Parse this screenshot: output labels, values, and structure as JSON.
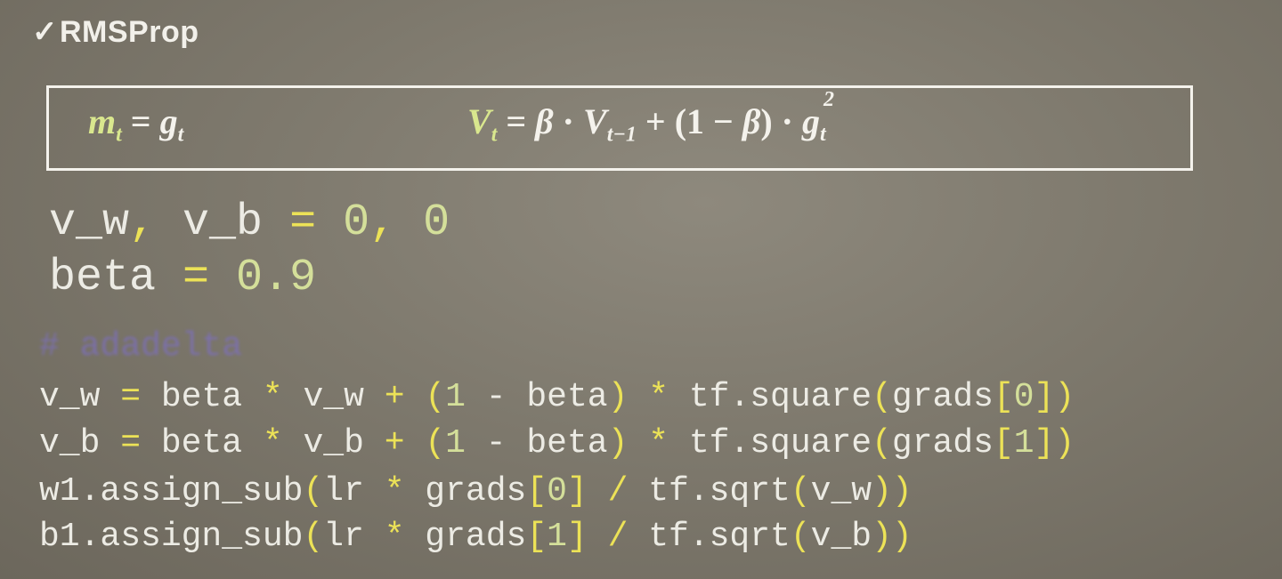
{
  "title": {
    "check": "✓",
    "text": "RMSProp"
  },
  "formulas": {
    "m": "m",
    "m_sub": "t",
    "eq1": " = ",
    "g": "g",
    "g_sub": "t",
    "V": "V",
    "V_sub": "t",
    "eq2": " = ",
    "beta1": "β",
    "dot1": " · ",
    "V2": "V",
    "V2_sub": "t−1",
    "plus": " + ",
    "lparen": "(",
    "one": "1",
    "minus": " − ",
    "beta2": "β",
    "rparen": ")",
    "dot2": " · ",
    "g2": "g",
    "g2_sup": "2",
    "g2_sub": "t"
  },
  "code": {
    "l1": {
      "a": "v_w",
      "b": ",",
      "c": " v_b ",
      "d": "=",
      "e": " 0",
      "f": ",",
      "g": " 0"
    },
    "l2": {
      "a": "beta ",
      "b": "=",
      "c": " 0.9"
    },
    "comment": "# adadelta",
    "l3": {
      "a": "v_w ",
      "b": "=",
      "c": " beta ",
      "d": "*",
      "e": " v_w ",
      "f": "+",
      "g": " ",
      "h": "(",
      "i": "1",
      "j": " - beta",
      "k": ")",
      "l": " ",
      "m": "*",
      "n": " tf.square",
      "o": "(",
      "p": "grads",
      "q": "[",
      "r": "0",
      "s": "]",
      "t": ")"
    },
    "l4": {
      "a": "v_b ",
      "b": "=",
      "c": " beta ",
      "d": "*",
      "e": " v_b ",
      "f": "+",
      "g": " ",
      "h": "(",
      "i": "1",
      "j": " - beta",
      "k": ")",
      "l": " ",
      "m": "*",
      "n": " tf.square",
      "o": "(",
      "p": "grads",
      "q": "[",
      "r": "1",
      "s": "]",
      "t": ")"
    },
    "l5": {
      "a": "w1.assign_sub",
      "b": "(",
      "c": "lr ",
      "d": "*",
      "e": " grads",
      "f": "[",
      "g": "0",
      "h": "]",
      "i": " / ",
      "j": "tf.sqrt",
      "k": "(",
      "l": "v_w",
      "m": "))"
    },
    "l6": {
      "a": "b1.assign_sub",
      "b": "(",
      "c": "lr ",
      "d": "*",
      "e": " grads",
      "f": "[",
      "g": "1",
      "h": "]",
      "i": " / ",
      "j": "tf.sqrt",
      "k": "(",
      "l": "v_b",
      "m": "))"
    }
  }
}
